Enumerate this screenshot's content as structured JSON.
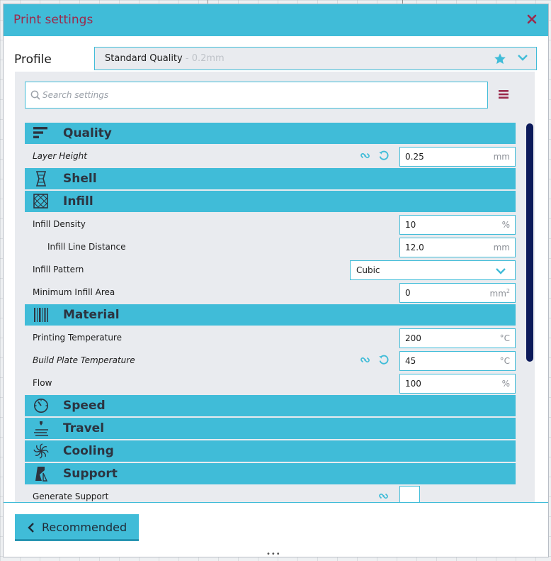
{
  "dialog": {
    "title": "Print settings"
  },
  "profile": {
    "label": "Profile",
    "name": "Standard Quality",
    "detail": " - 0.2mm"
  },
  "search": {
    "placeholder": "Search settings"
  },
  "categories": {
    "quality": "Quality",
    "shell": "Shell",
    "infill": "Infill",
    "material": "Material",
    "speed": "Speed",
    "travel": "Travel",
    "cooling": "Cooling",
    "support": "Support"
  },
  "settings": {
    "layer_height": {
      "label": "Layer Height",
      "value": "0.25",
      "unit": "mm"
    },
    "infill_density": {
      "label": "Infill Density",
      "value": "10",
      "unit": "%"
    },
    "infill_line_distance": {
      "label": "Infill Line Distance",
      "value": "12.0",
      "unit": "mm"
    },
    "infill_pattern": {
      "label": "Infill Pattern",
      "value": "Cubic"
    },
    "min_infill_area": {
      "label": "Minimum Infill Area",
      "value": "0",
      "unit": "mm",
      "unit_sup": "2"
    },
    "printing_temperature": {
      "label": "Printing Temperature",
      "value": "200",
      "unit": "°C"
    },
    "build_plate_temperature": {
      "label": "Build Plate Temperature",
      "value": "45",
      "unit": "°C"
    },
    "flow": {
      "label": "Flow",
      "value": "100",
      "unit": "%"
    },
    "generate_support": {
      "label": "Generate Support"
    }
  },
  "footer": {
    "recommended_label": "Recommended",
    "dots": "•••"
  },
  "colors": {
    "accent": "#40bcd8",
    "title_text": "#9b2a4c",
    "close_icon": "#9b2a4c",
    "scrollbar": "#0c1a5a"
  }
}
